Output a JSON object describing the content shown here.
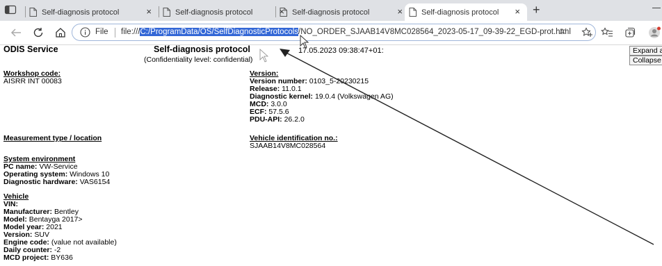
{
  "browser": {
    "tabs": [
      {
        "label": "Self-diagnosis protocol",
        "active": false
      },
      {
        "label": "Self-diagnosis protocol",
        "active": false
      },
      {
        "label": "Self-diagnosis protocol",
        "active": false
      },
      {
        "label": "Self-diagnosis protocol",
        "active": true
      }
    ],
    "close_glyph": "×",
    "new_tab_glyph": "+",
    "file_label": "File",
    "url_prefix": "file:///",
    "url_selected": "C:/ProgramData/OS/SelfDiagnosticProtocols",
    "url_rest": "/NO_ORDER_SJAAB14V8MC028564_2023-05-17_09-39-22_EGD-prot.html",
    "read_aloud_label": "Aʼ"
  },
  "document": {
    "app_name": "ODIS Service",
    "title": "Self-diagnosis protocol",
    "confidentiality": "(Confidentiality level: confidential)",
    "timestamp": "17.05.2023 09:38:47+01:",
    "expand_button": "Expand all",
    "collapse_button": "Collapse all",
    "workshop": {
      "heading": "Workshop code:",
      "value": "AISRR INT 00083"
    },
    "version": {
      "heading": "Version:",
      "number_label": "Version number:",
      "number_value": "0103_5-20230215",
      "release_label": "Release:",
      "release_value": "11.0.1",
      "kernel_label": "Diagnostic kernel:",
      "kernel_value": "19.0.4 (Volkswagen AG)",
      "mcd_label": "MCD:",
      "mcd_value": "3.0.0",
      "ecf_label": "ECF:",
      "ecf_value": "57.5.6",
      "pdu_label": "PDU-API:",
      "pdu_value": "26.2.0"
    },
    "measurement": {
      "heading": "Measurement type / location"
    },
    "vin_block": {
      "heading": "Vehicle identification no.:",
      "value": "SJAAB14V8MC028564"
    },
    "system": {
      "heading": "System environment",
      "pc_label": "PC name:",
      "pc_value": "VW-Service",
      "os_label": "Operating system:",
      "os_value": "Windows 10",
      "hw_label": "Diagnostic hardware:",
      "hw_value": "VAS6154"
    },
    "vehicle": {
      "heading": "Vehicle",
      "vin_label": "VIN:",
      "manufacturer_label": "Manufacturer:",
      "manufacturer_value": "Bentley",
      "model_label": "Model:",
      "model_value": "Bentayga 2017>",
      "year_label": "Model year:",
      "year_value": "2021",
      "version_label": "Version:",
      "version_value": "SUV",
      "engine_label": "Engine code:",
      "engine_value": "(value not available)",
      "counter_label": "Daily counter:",
      "counter_value": "-2",
      "mcd_label": "MCD project:",
      "mcd_value": "BY636"
    }
  }
}
